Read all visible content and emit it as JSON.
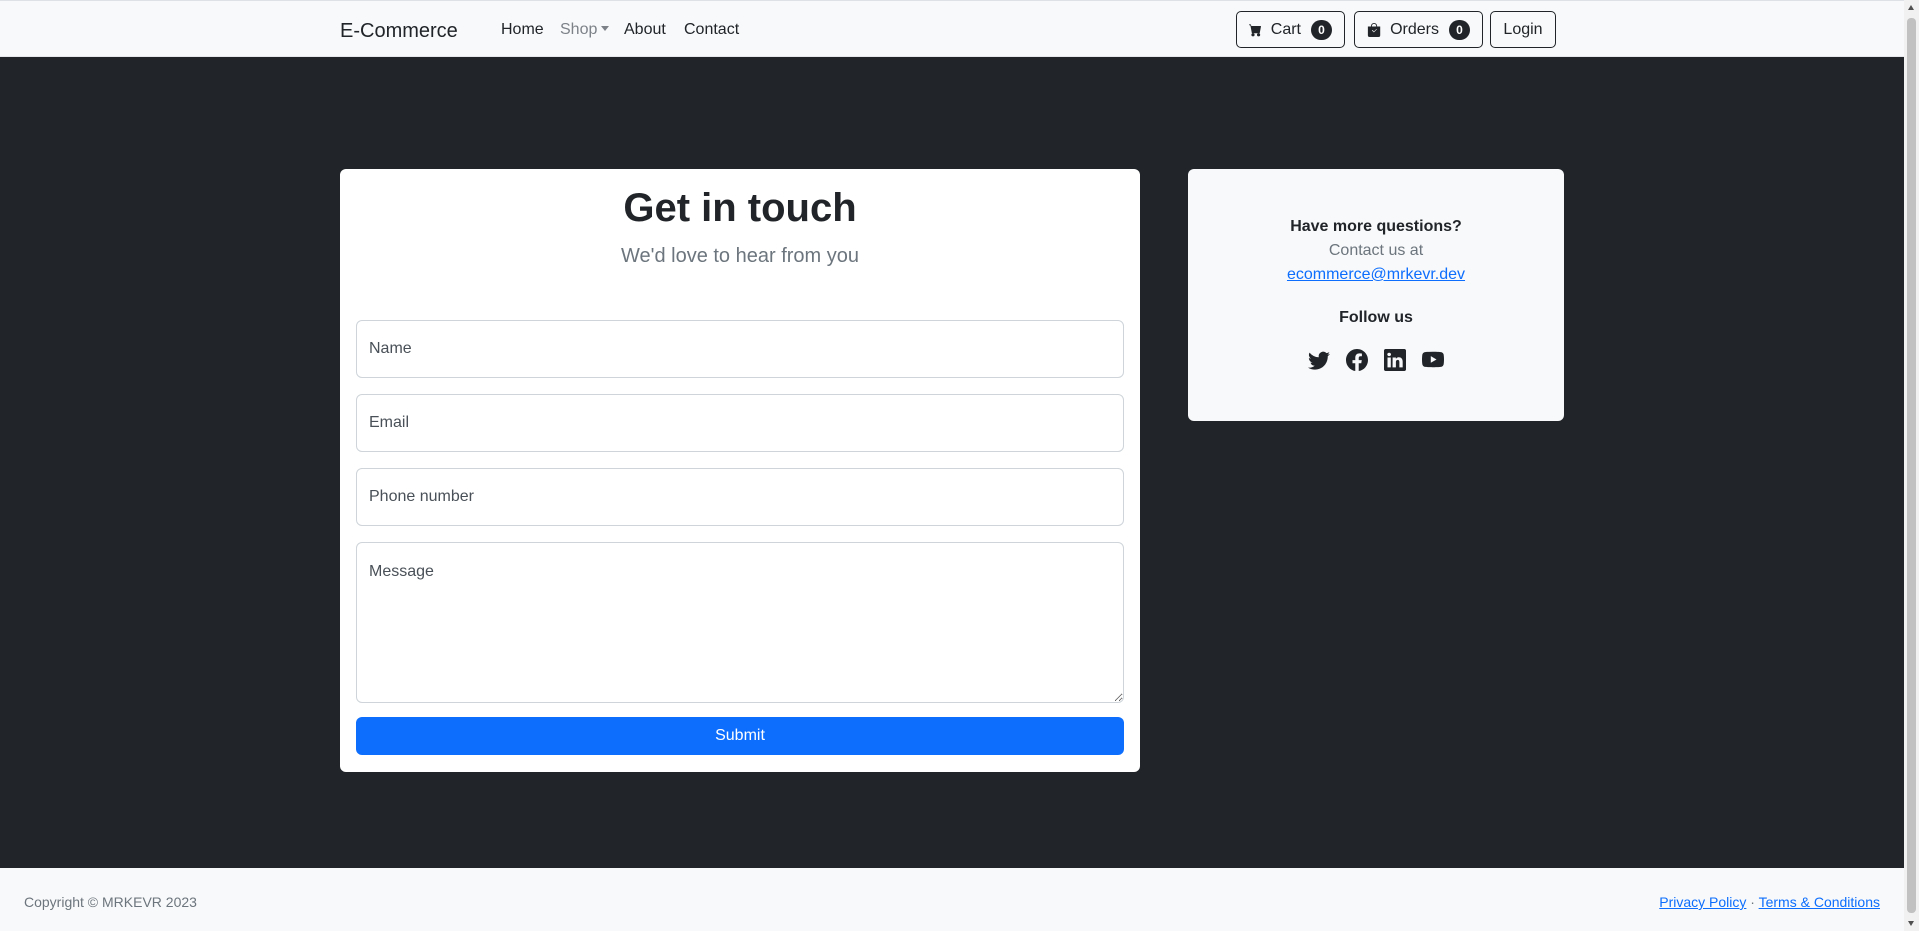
{
  "nav": {
    "brand": "E-Commerce",
    "links": [
      "Home",
      "Shop",
      "About",
      "Contact"
    ],
    "cart_label": "Cart",
    "cart_count": "0",
    "orders_label": "Orders",
    "orders_count": "0",
    "login_label": "Login"
  },
  "form": {
    "title": "Get in touch",
    "subtitle": "We'd love to hear from you",
    "name_placeholder": "Name",
    "email_placeholder": "Email",
    "phone_placeholder": "Phone number",
    "message_placeholder": "Message",
    "submit_label": "Submit"
  },
  "info": {
    "questions_heading": "Have more questions?",
    "contact_text": "Contact us at",
    "email": "ecommerce@mrkevr.dev",
    "follow_heading": "Follow us",
    "social_icons": [
      "twitter-icon",
      "facebook-icon",
      "linkedin-icon",
      "youtube-icon"
    ]
  },
  "footer": {
    "copyright": "Copyright © MRKEVR 2023",
    "privacy": "Privacy Policy",
    "separator": "·",
    "terms": "Terms & Conditions"
  },
  "colors": {
    "primary": "#0d6efd",
    "dark": "#212529",
    "light": "#f8f9fa",
    "muted": "#6c757d"
  }
}
